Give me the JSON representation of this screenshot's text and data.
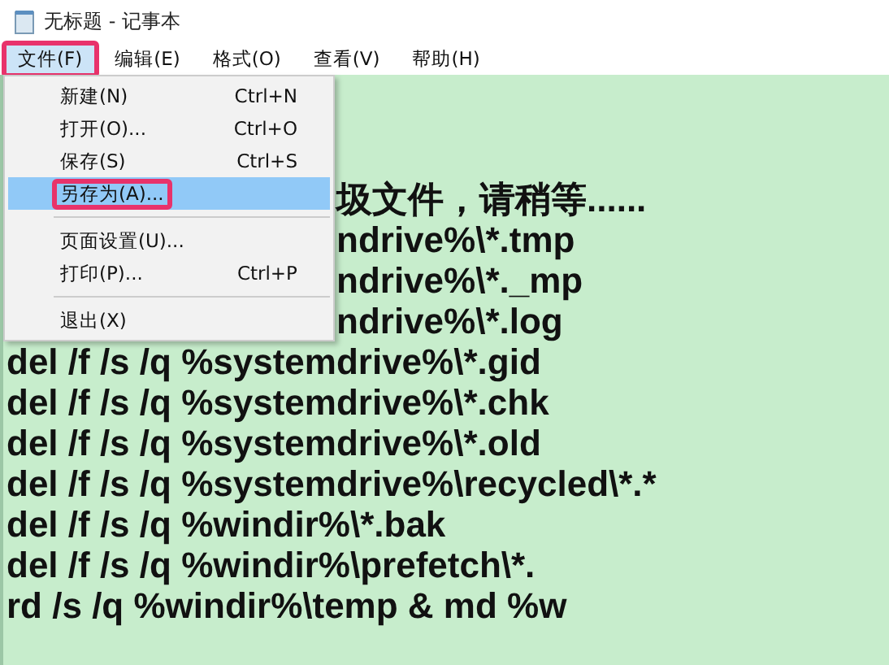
{
  "window": {
    "title": "无标题 - 记事本"
  },
  "menubar": [
    {
      "label": "文件(F)",
      "selected": true,
      "annotated": true
    },
    {
      "label": "编辑(E)",
      "selected": false,
      "annotated": false
    },
    {
      "label": "格式(O)",
      "selected": false,
      "annotated": false
    },
    {
      "label": "查看(V)",
      "selected": false,
      "annotated": false
    },
    {
      "label": "帮助(H)",
      "selected": false,
      "annotated": false
    }
  ],
  "dropdown": [
    {
      "kind": "item",
      "label": "新建(N)",
      "shortcut": "Ctrl+N",
      "selected": false,
      "annotated": false
    },
    {
      "kind": "item",
      "label": "打开(O)...",
      "shortcut": "Ctrl+O",
      "selected": false,
      "annotated": false
    },
    {
      "kind": "item",
      "label": "保存(S)",
      "shortcut": "Ctrl+S",
      "selected": false,
      "annotated": false
    },
    {
      "kind": "item",
      "label": "另存为(A)...",
      "selected": true,
      "annotated": true
    },
    {
      "kind": "separator"
    },
    {
      "kind": "item",
      "label": "页面设置(U)...",
      "selected": false,
      "annotated": false
    },
    {
      "kind": "item",
      "label": "打印(P)...",
      "shortcut": "Ctrl+P",
      "selected": false,
      "annotated": false
    },
    {
      "kind": "separator"
    },
    {
      "kind": "item",
      "label": "退出(X)",
      "selected": false,
      "annotated": false
    }
  ],
  "editor": {
    "lines": [
      {
        "kind": "partial",
        "text": "圾文件，请稍等......"
      },
      {
        "kind": "partial",
        "text": "ndrive%\\*.tmp"
      },
      {
        "kind": "partial",
        "text": "ndrive%\\*._mp"
      },
      {
        "kind": "partial",
        "text": "ndrive%\\*.log"
      },
      {
        "kind": "full",
        "text": "del /f /s /q %systemdrive%\\*.gid"
      },
      {
        "kind": "full",
        "text": "del /f /s /q %systemdrive%\\*.chk"
      },
      {
        "kind": "full",
        "text": "del /f /s /q %systemdrive%\\*.old"
      },
      {
        "kind": "full",
        "text": "del /f /s /q %systemdrive%\\recycled\\*.*"
      },
      {
        "kind": "full",
        "text": "del /f /s /q %windir%\\*.bak"
      },
      {
        "kind": "full",
        "text": "del /f /s /q %windir%\\prefetch\\*."
      },
      {
        "kind": "full",
        "text": "rd /s /q %windir%\\temp & md %w"
      }
    ]
  }
}
